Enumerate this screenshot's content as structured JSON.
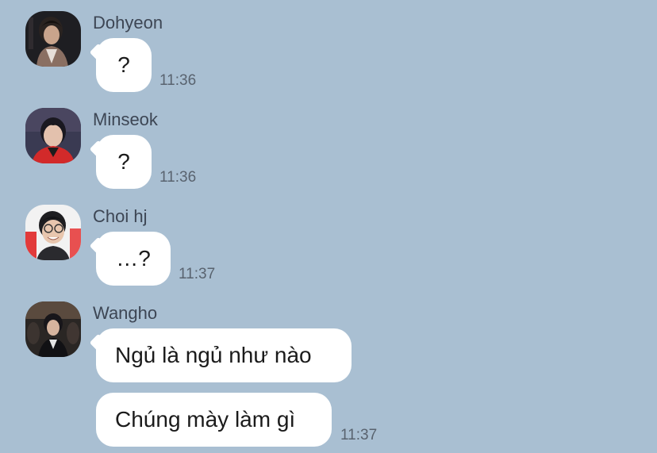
{
  "messages": [
    {
      "sender": "Dohyeon",
      "avatar": "dohyeon-avatar",
      "bubbles": [
        {
          "text": "?"
        }
      ],
      "time": "11:36"
    },
    {
      "sender": "Minseok",
      "avatar": "minseok-avatar",
      "bubbles": [
        {
          "text": "?"
        }
      ],
      "time": "11:36"
    },
    {
      "sender": "Choi hj",
      "avatar": "choi-hj-avatar",
      "bubbles": [
        {
          "text": "…?"
        }
      ],
      "time": "11:37"
    },
    {
      "sender": "Wangho",
      "avatar": "wangho-avatar",
      "bubbles": [
        {
          "text": "Ngủ là ngủ như nào"
        },
        {
          "text": "Chúng mày làm gì"
        }
      ],
      "time": "11:37"
    }
  ],
  "colors": {
    "background": "#a9bfd2",
    "bubble": "#ffffff",
    "sender_text": "#3d4654",
    "time_text": "#59636f"
  }
}
